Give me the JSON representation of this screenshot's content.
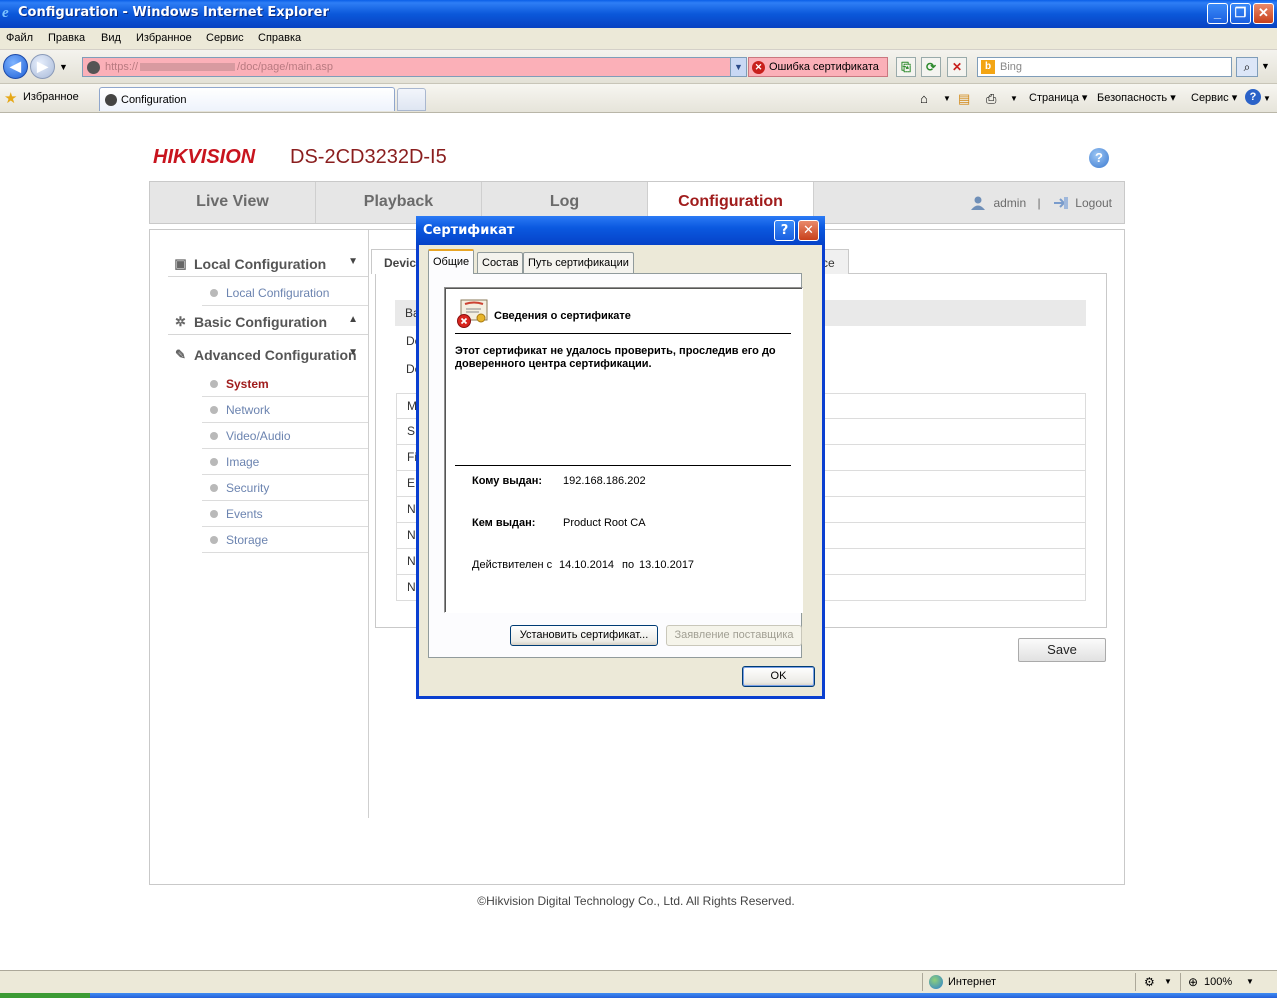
{
  "window": {
    "title": "Configuration - Windows Internet Explorer",
    "controls": {
      "minimize": "_",
      "maximize": "❐",
      "close": "✕"
    }
  },
  "menubar": [
    "Файл",
    "Правка",
    "Вид",
    "Избранное",
    "Сервис",
    "Справка"
  ],
  "addressbar": {
    "url_prefix": "https://",
    "url_path": "/doc/page/main.asp",
    "cert_error": "Ошибка сертификата",
    "search_placeholder": "Bing"
  },
  "favbar": {
    "favorites": "Избранное",
    "tab_title": "Configuration",
    "commands": [
      "Страница",
      "Безопасность",
      "Сервис"
    ]
  },
  "page": {
    "logo": "HIKVISION",
    "model": "DS-2CD3232D-I5",
    "help": "?",
    "nav": [
      "Live View",
      "Playback",
      "Log",
      "Configuration"
    ],
    "user": "admin",
    "user_sep": "|",
    "logout": "Logout",
    "sidebar": {
      "local_section": "Local Configuration",
      "local_items": [
        "Local Configuration"
      ],
      "basic_section": "Basic Configuration",
      "advanced_section": "Advanced Configuration",
      "advanced_items": [
        "System",
        "Network",
        "Video/Audio",
        "Image",
        "Security",
        "Events",
        "Storage"
      ]
    },
    "content": {
      "tab_device": "Device",
      "tab_right": "ce",
      "basic_row": "Ba",
      "rows_plain": [
        "De",
        "De"
      ],
      "rows_table": [
        "M",
        "S",
        "Fi",
        "E",
        "N",
        "N",
        "N",
        "N"
      ]
    },
    "save": "Save",
    "copyright": "©Hikvision Digital Technology Co., Ltd. All Rights Reserved."
  },
  "dialog": {
    "title": "Сертификат",
    "help": "?",
    "close": "✕",
    "tabs": [
      "Общие",
      "Состав",
      "Путь сертификации"
    ],
    "heading": "Сведения о сертификате",
    "message": "Этот сертификат не удалось проверить, проследив его до доверенного центра сертификации.",
    "issued_to_label": "Кому выдан:",
    "issued_to": "192.168.186.202",
    "issued_by_label": "Кем выдан:",
    "issued_by": "Product Root CA",
    "valid_from_label": "Действителен с",
    "valid_from": "14.10.2014",
    "valid_to_label": "по",
    "valid_to": "13.10.2017",
    "install_button": "Установить сертификат...",
    "issuer_statement_button": "Заявление поставщика",
    "ok_button": "OK"
  },
  "statusbar": {
    "zone": "Интернет",
    "zoom": "100%"
  }
}
